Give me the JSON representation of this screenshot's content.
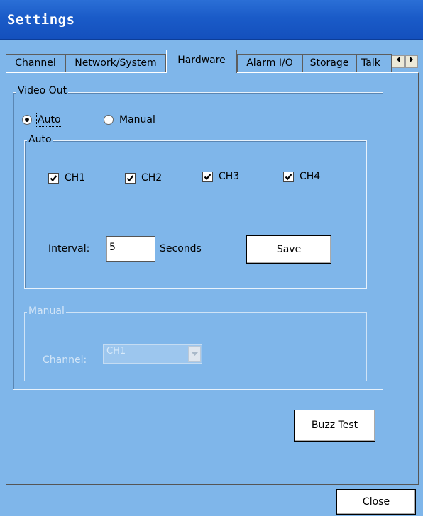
{
  "window": {
    "title": "Settings"
  },
  "tabs": [
    {
      "label": "Channel"
    },
    {
      "label": "Network/System"
    },
    {
      "label": "Hardware"
    },
    {
      "label": "Alarm I/O"
    },
    {
      "label": "Storage"
    },
    {
      "label": "Talk"
    }
  ],
  "active_tab": "Hardware",
  "video_out": {
    "legend": "Video Out",
    "mode_auto_label": "Auto",
    "mode_manual_label": "Manual",
    "selected_mode": "Auto",
    "auto_group": {
      "legend": "Auto",
      "channels": [
        {
          "label": "CH1",
          "checked": true
        },
        {
          "label": "CH2",
          "checked": true
        },
        {
          "label": "CH3",
          "checked": true
        },
        {
          "label": "CH4",
          "checked": true
        }
      ],
      "interval_label": "Interval:",
      "interval_value": "5",
      "interval_unit": "Seconds",
      "save_label": "Save"
    },
    "manual_group": {
      "legend": "Manual",
      "channel_label": "Channel:",
      "channel_value": "CH1"
    }
  },
  "buzz_test_label": "Buzz Test",
  "close_label": "Close",
  "colors": {
    "titlebar": "#1a5bc8",
    "panel_bg": "#7fb6ea",
    "disabled_text": "#d2e5f7"
  }
}
